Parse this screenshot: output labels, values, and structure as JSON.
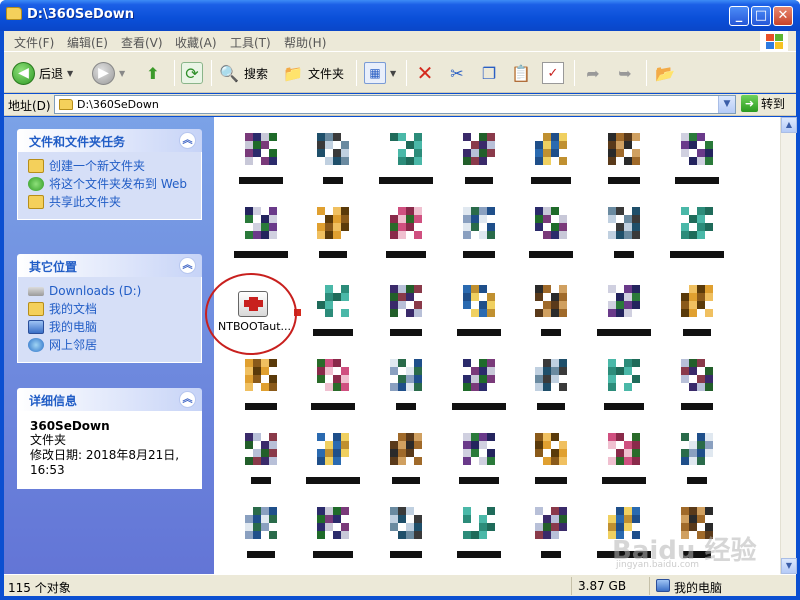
{
  "window": {
    "title": "D:\\360SeDown"
  },
  "titlebar_buttons": {
    "minimize": "_",
    "maximize": "□",
    "close": "✕"
  },
  "menu": [
    "文件(F)",
    "编辑(E)",
    "查看(V)",
    "收藏(A)",
    "工具(T)",
    "帮助(H)"
  ],
  "toolbar": {
    "back_label": "后退",
    "search_label": "搜索",
    "folders_label": "文件夹"
  },
  "address": {
    "label": "地址(D)",
    "value": "D:\\360SeDown",
    "go_label": "转到"
  },
  "tasks_panel": {
    "title": "文件和文件夹任务",
    "items": [
      "创建一个新文件夹",
      "将这个文件夹发布到 Web",
      "共享此文件夹"
    ]
  },
  "places_panel": {
    "title": "其它位置",
    "items": [
      "Downloads (D:)",
      "我的文档",
      "我的电脑",
      "网上邻居"
    ]
  },
  "details_panel": {
    "title": "详细信息",
    "name": "360SeDown",
    "type": "文件夹",
    "modified": "修改日期: 2018年8月21日, 16:53"
  },
  "selected_file": {
    "label": "NTBOOTaut..."
  },
  "statusbar": {
    "count": "115 个对象",
    "size": "3.87 GB",
    "location": "我的电脑"
  },
  "watermark": {
    "text": "Baidu 经验",
    "sub": "jingyan.baidu.com"
  },
  "colors": {
    "title_blue": "#0a4fd8",
    "panel_link": "#215dc6",
    "highlight_circle": "#c8201e"
  }
}
